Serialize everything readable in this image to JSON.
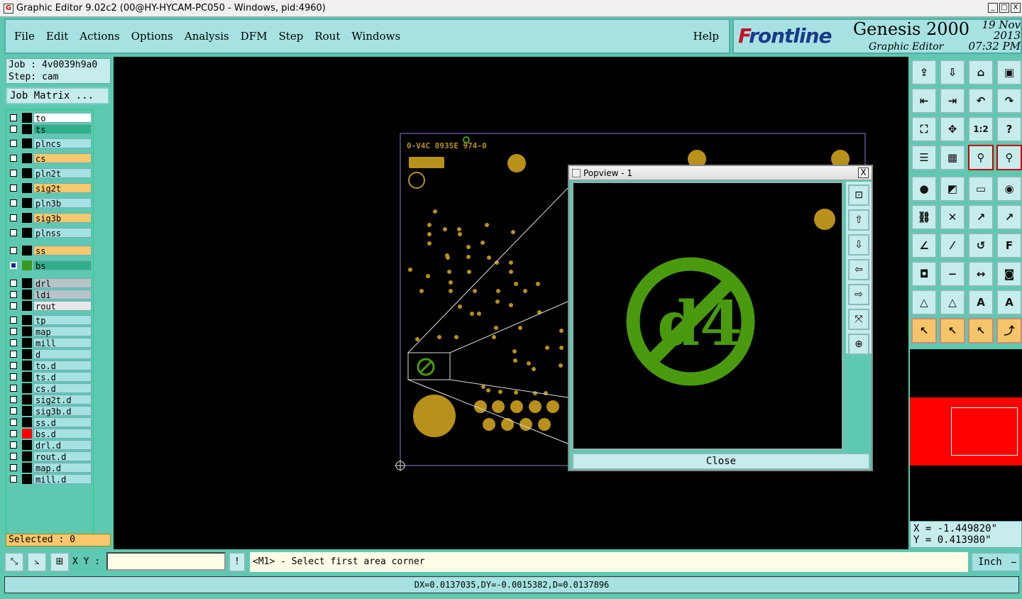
{
  "window": {
    "title": "Graphic Editor 9.02c2 (00@HY-HYCAM-PC050 - Windows, pid:4960)",
    "buttons": [
      "_",
      "□",
      "X"
    ]
  },
  "menu": {
    "items": [
      {
        "label": "File",
        "key": "menu-file"
      },
      {
        "label": "Edit",
        "key": "menu-edit"
      },
      {
        "label": "Actions",
        "key": "menu-actions"
      },
      {
        "label": "Options",
        "key": "menu-options"
      },
      {
        "label": "Analysis",
        "key": "menu-analysis"
      },
      {
        "label": "DFM",
        "key": "menu-dfm"
      },
      {
        "label": "Step",
        "key": "menu-step"
      },
      {
        "label": "Rout",
        "key": "menu-rout"
      },
      {
        "label": "Windows",
        "key": "menu-windows"
      }
    ],
    "help": "Help"
  },
  "brand": {
    "logo_front": "F",
    "logo_rest": "rontline",
    "product": "Genesis 2000",
    "subtitle": "Graphic Editor",
    "date": "19 Nov 2013",
    "time": "07:32 PM"
  },
  "job": {
    "job_line": "Job : 4v0039h9a0",
    "step_line": "Step: cam",
    "matrix_label": "Job Matrix ..."
  },
  "layers": [
    {
      "name": "to",
      "color": "#ffffff",
      "swatch": "#000000"
    },
    {
      "name": "ts",
      "color": "#2fb08a",
      "swatch": "#000000"
    },
    {
      "name": "plncs",
      "color": "#a6e2e2",
      "swatch": "#000000"
    },
    {
      "name": "cs",
      "color": "#f7c86d",
      "swatch": "#000000"
    },
    {
      "name": "pln2t",
      "color": "#a6e2e2",
      "swatch": "#000000"
    },
    {
      "name": "sig2t",
      "color": "#f7c86d",
      "swatch": "#000000"
    },
    {
      "name": "pln3b",
      "color": "#a6e2e2",
      "swatch": "#000000"
    },
    {
      "name": "sig3b",
      "color": "#f7c86d",
      "swatch": "#000000"
    },
    {
      "name": "plnss",
      "color": "#a6e2e2",
      "swatch": "#000000"
    },
    {
      "name": "ss",
      "color": "#f7c86d",
      "swatch": "#000000"
    },
    {
      "name": "bs",
      "color": "#2fb08a",
      "swatch": "#3a9a20",
      "checked": true
    },
    {
      "name": "drl",
      "color": "#b6c4c8",
      "swatch": "#000000"
    },
    {
      "name": "ldi",
      "color": "#b6c4c8",
      "swatch": "#000000"
    },
    {
      "name": "rout",
      "color": "#e8e8e8",
      "swatch": "#000000"
    },
    {
      "name": "tp",
      "color": "#a6e2e2",
      "swatch": "#000000"
    },
    {
      "name": "map",
      "color": "#a6e2e2",
      "swatch": "#000000"
    },
    {
      "name": "mill",
      "color": "#a6e2e2",
      "swatch": "#000000"
    },
    {
      "name": "d",
      "color": "#a6e2e2",
      "swatch": "#000000"
    },
    {
      "name": "to.d",
      "color": "#a6e2e2",
      "swatch": "#000000"
    },
    {
      "name": "ts.d",
      "color": "#a6e2e2",
      "swatch": "#000000"
    },
    {
      "name": "cs.d",
      "color": "#a6e2e2",
      "swatch": "#000000"
    },
    {
      "name": "sig2t.d",
      "color": "#a6e2e2",
      "swatch": "#000000"
    },
    {
      "name": "sig3b.d",
      "color": "#a6e2e2",
      "swatch": "#000000"
    },
    {
      "name": "ss.d",
      "color": "#a6e2e2",
      "swatch": "#000000"
    },
    {
      "name": "bs.d",
      "color": "#a6e2e2",
      "swatch": "#ff0000"
    },
    {
      "name": "drl.d",
      "color": "#a6e2e2",
      "swatch": "#000000"
    },
    {
      "name": "rout.d",
      "color": "#a6e2e2",
      "swatch": "#000000"
    },
    {
      "name": "map.d",
      "color": "#a6e2e2",
      "swatch": "#000000"
    },
    {
      "name": "mill.d",
      "color": "#a6e2e2",
      "swatch": "#000000"
    }
  ],
  "selected": "Selected : 0",
  "popup": {
    "title": "Popview - 1",
    "close_label": "Close",
    "close_x": "X"
  },
  "coords": {
    "x": "X = -1.449820\"",
    "y": "Y = 0.413980\""
  },
  "bottom": {
    "xy_label": "X Y :",
    "xy_value": "",
    "prompt": "<M1> - Select first area corner",
    "units": "Inch",
    "info_btn": "!"
  },
  "status": "DX=0.0137035,DY=-0.0015382,D=0.0137896",
  "colors": {
    "pad": "#b8901a",
    "symbol": "#4a9a10",
    "panel": "#5ec9b0",
    "button": "#c7ecec"
  }
}
